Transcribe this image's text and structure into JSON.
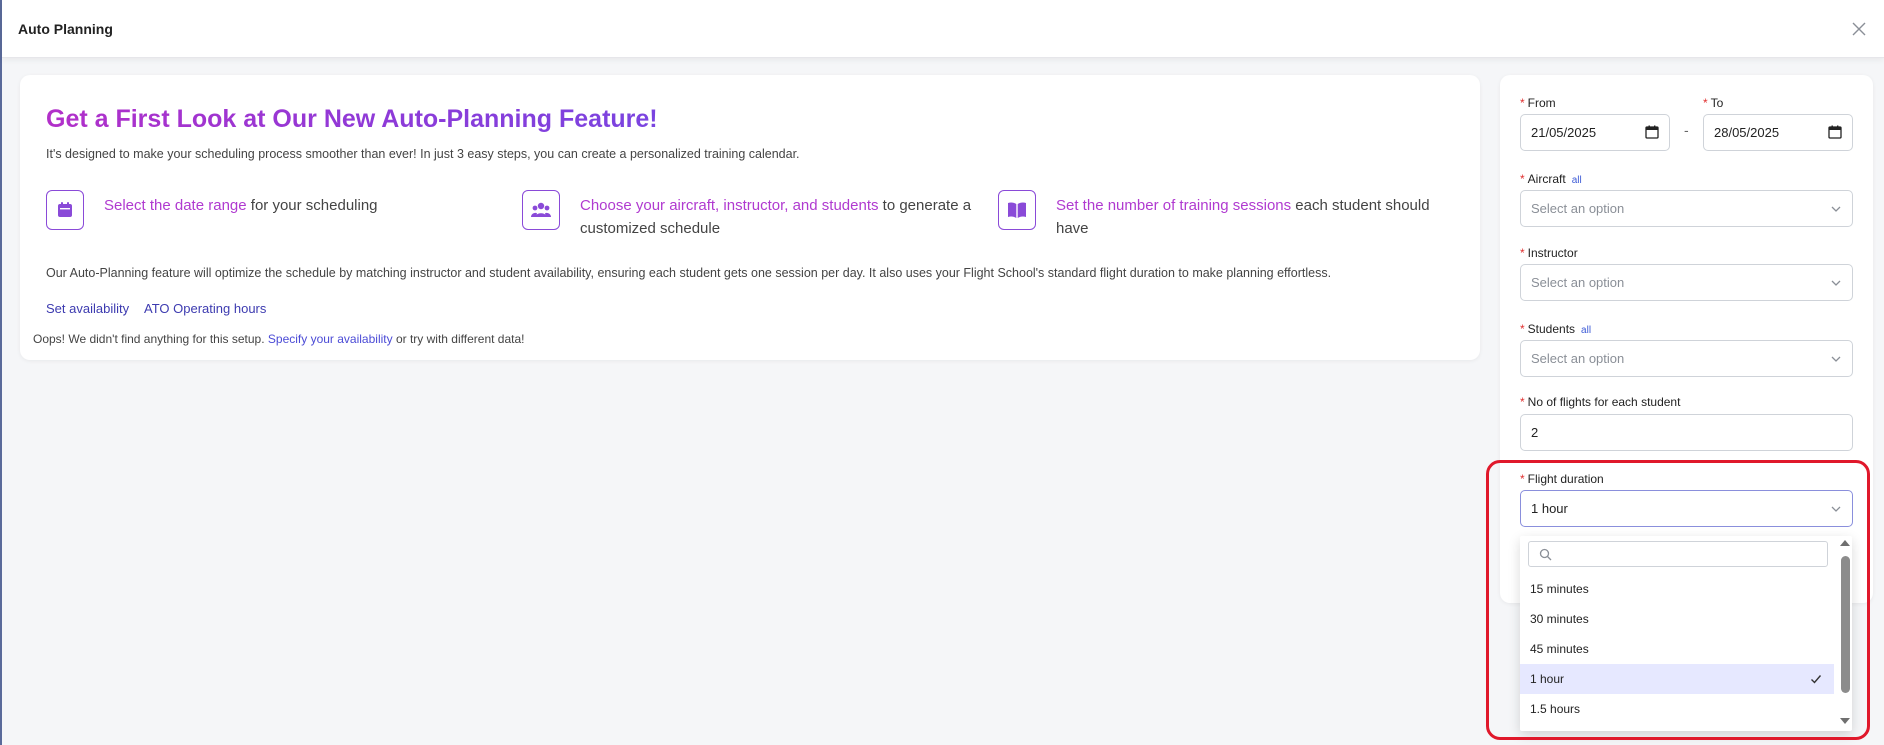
{
  "modal": {
    "title": "Auto Planning"
  },
  "info": {
    "headline": "Get a First Look at Our New Auto-Planning Feature!",
    "intro": "It's designed to make your scheduling process smoother than ever! In just 3 easy steps, you can create a personalized training calendar.",
    "steps": [
      {
        "icon": "calendar-icon",
        "highlight": "Select the date range",
        "rest": " for your scheduling",
        "rest2": ""
      },
      {
        "icon": "users-icon",
        "highlight": "Choose your aircraft, instructor, and students",
        "rest": " to generate a",
        "rest2": "customized schedule"
      },
      {
        "icon": "book-icon",
        "highlight": "Set the number of training sessions",
        "rest": " each student should",
        "rest2": "have"
      }
    ],
    "summary": "Our Auto-Planning feature will optimize the schedule by matching instructor and student availability, ensuring each student gets one session per day. It also uses your Flight School's standard flight duration to make planning effortless.",
    "links": {
      "set_availability": "Set availability",
      "operating_hours": "ATO Operating hours"
    },
    "oops": {
      "prefix": "Oops! We didn't find anything for this setup.",
      "link": "Specify your availability",
      "suffix": "or try with different data!"
    }
  },
  "form": {
    "required_mark": "*",
    "from": {
      "label": "From",
      "value": "21/05/2025"
    },
    "to": {
      "label": "To",
      "value": "28/05/2025"
    },
    "separator": "-",
    "aircraft": {
      "label": "Aircraft",
      "tag": "all",
      "placeholder": "Select an option"
    },
    "instructor": {
      "label": "Instructor",
      "placeholder": "Select an option"
    },
    "students": {
      "label": "Students",
      "tag": "all",
      "placeholder": "Select an option"
    },
    "flights": {
      "label": "No of flights for each student",
      "value": "2"
    },
    "duration": {
      "label": "Flight duration",
      "value": "1 hour",
      "options": [
        "15 minutes",
        "30 minutes",
        "45 minutes",
        "1 hour",
        "1.5 hours"
      ],
      "selected_index": 3
    }
  },
  "colors": {
    "accent": "#8a4ad8",
    "link": "#3d3bb0",
    "highlight_frame": "#e0182b",
    "selected_option_bg": "#e6e8ff"
  }
}
